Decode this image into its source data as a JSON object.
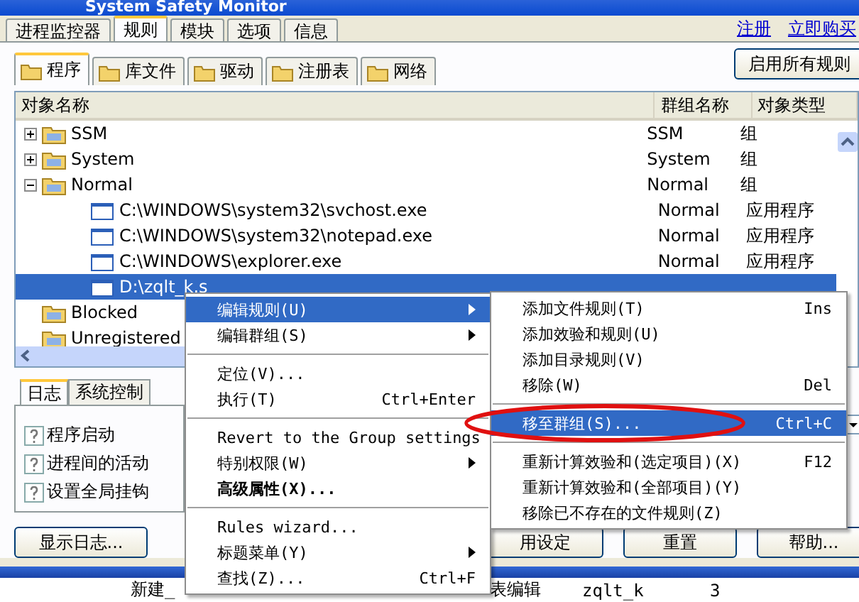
{
  "window": {
    "title": "System Safety Monitor"
  },
  "main_tabs": [
    {
      "label": "进程监控器",
      "selected": false
    },
    {
      "label": "规则",
      "selected": true
    },
    {
      "label": "模块",
      "selected": false
    },
    {
      "label": "选项",
      "selected": false
    },
    {
      "label": "信息",
      "selected": false
    }
  ],
  "header_links": [
    "注册",
    "立即购买"
  ],
  "sub_tabs": [
    {
      "label": "程序",
      "selected": true
    },
    {
      "label": "库文件",
      "selected": false
    },
    {
      "label": "驱动",
      "selected": false
    },
    {
      "label": "注册表",
      "selected": false
    },
    {
      "label": "网络",
      "selected": false
    }
  ],
  "enable_all_button": "启用所有规则",
  "table": {
    "columns": [
      "对象名称",
      "群组名称",
      "对象类型"
    ],
    "rows": [
      {
        "kind": "group",
        "name": "SSM",
        "group": "SSM",
        "type": "组",
        "expanded": false,
        "selected": false
      },
      {
        "kind": "group",
        "name": "System",
        "group": "System",
        "type": "组",
        "expanded": false,
        "selected": false
      },
      {
        "kind": "group",
        "name": "Normal",
        "group": "Normal",
        "type": "组",
        "expanded": true,
        "selected": false,
        "children": [
          {
            "kind": "file",
            "name": "C:\\WINDOWS\\system32\\svchost.exe",
            "group": "Normal",
            "type": "应用程序",
            "selected": false
          },
          {
            "kind": "file",
            "name": "C:\\WINDOWS\\system32\\notepad.exe",
            "group": "Normal",
            "type": "应用程序",
            "selected": false
          },
          {
            "kind": "file",
            "name": "C:\\WINDOWS\\explorer.exe",
            "group": "Normal",
            "type": "应用程序",
            "selected": false
          },
          {
            "kind": "file",
            "name": "D:\\zqlt_k.s",
            "selected": true
          }
        ]
      },
      {
        "kind": "group",
        "name": "Blocked",
        "selected": false
      },
      {
        "kind": "group",
        "name": "Unregistered",
        "selected": false
      }
    ]
  },
  "bottom_tabs": [
    {
      "label": "日志",
      "selected": true
    },
    {
      "label": "系统控制",
      "selected": false
    }
  ],
  "log_items": [
    "程序启动",
    "进程间的活动",
    "设置全局挂钩"
  ],
  "buttons": [
    "显示日志...",
    "用设定",
    "重置",
    "帮助..."
  ],
  "taskbar_row": [
    "新建_",
    "表编辑",
    "zqlt_k",
    "3"
  ],
  "context_menu": [
    {
      "kind": "item",
      "label": "编辑规则(U)",
      "submenu": true,
      "selected": true
    },
    {
      "kind": "item",
      "label": "编辑群组(S)",
      "submenu": true,
      "selected": false
    },
    {
      "kind": "separator"
    },
    {
      "kind": "item",
      "label": "定位(V)...",
      "selected": false
    },
    {
      "kind": "item",
      "label": "执行(T)",
      "shortcut": "Ctrl+Enter",
      "selected": false
    },
    {
      "kind": "separator"
    },
    {
      "kind": "item",
      "label": "Revert to the Group settings",
      "selected": false
    },
    {
      "kind": "item",
      "label": "特别权限(W)",
      "submenu": true,
      "selected": false
    },
    {
      "kind": "item",
      "label": "高级属性(X)...",
      "bold": true,
      "selected": false
    },
    {
      "kind": "separator"
    },
    {
      "kind": "item",
      "label": "Rules wizard...",
      "selected": false
    },
    {
      "kind": "item",
      "label": "标题菜单(Y)",
      "submenu": true,
      "selected": false
    },
    {
      "kind": "item",
      "label": "查找(Z)...",
      "shortcut": "Ctrl+F",
      "selected": false
    }
  ],
  "submenu": [
    {
      "kind": "item",
      "label": "添加文件规则(T)",
      "shortcut": "Ins",
      "selected": false
    },
    {
      "kind": "item",
      "label": "添加效验和规则(U)",
      "selected": false
    },
    {
      "kind": "item",
      "label": "添加目录规则(V)",
      "selected": false
    },
    {
      "kind": "item",
      "label": "移除(W)",
      "shortcut": "Del",
      "selected": false
    },
    {
      "kind": "separator"
    },
    {
      "kind": "item",
      "label": "移至群组(S)...",
      "shortcut": "Ctrl+C",
      "selected": true,
      "circled": true
    },
    {
      "kind": "separator"
    },
    {
      "kind": "item",
      "label": "重新计算效验和(选定项目)(X)",
      "shortcut": "F12",
      "selected": false
    },
    {
      "kind": "item",
      "label": "重新计算效验和(全部项目)(Y)",
      "selected": false
    },
    {
      "kind": "item",
      "label": "移除已不存在的文件规则(Z)",
      "selected": false
    }
  ]
}
